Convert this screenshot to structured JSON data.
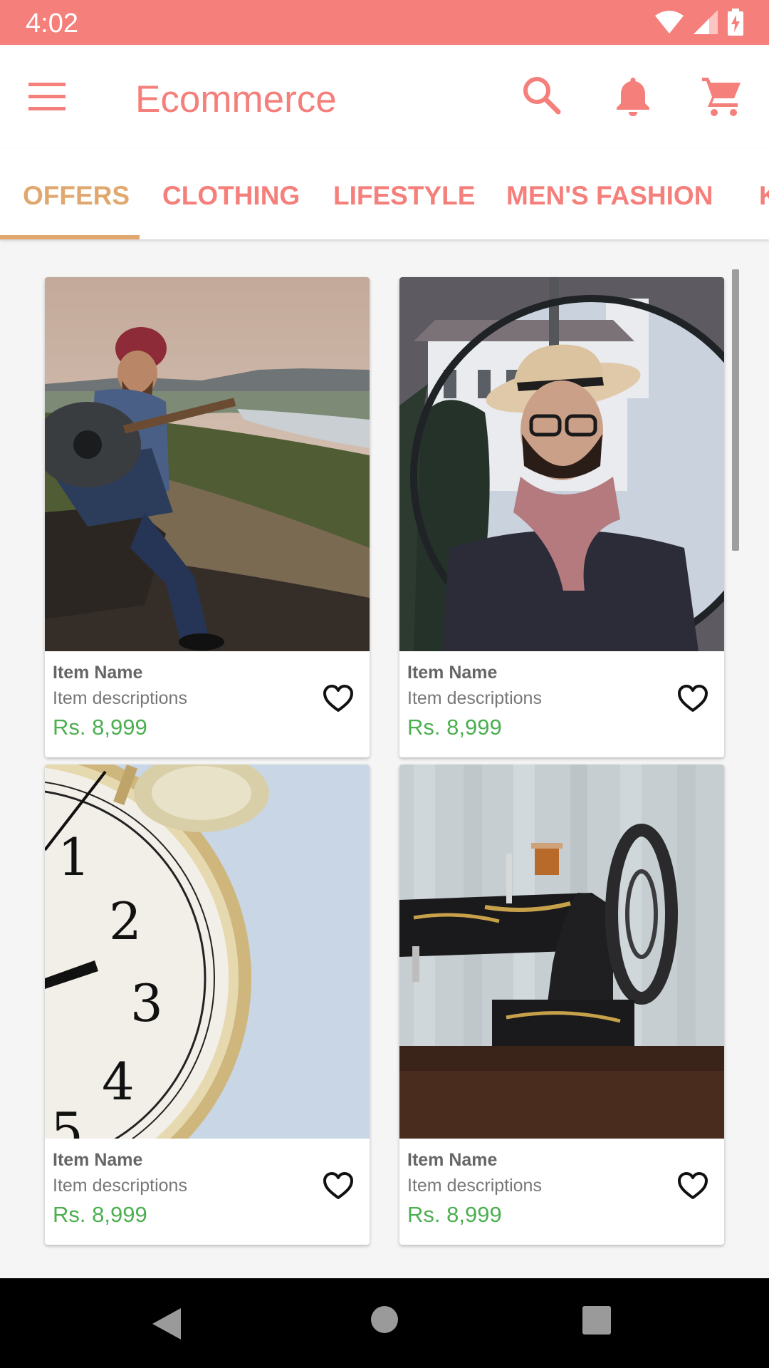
{
  "status_bar": {
    "time": "4:02"
  },
  "app_bar": {
    "title": "Ecommerce"
  },
  "tabs": [
    {
      "label": "OFFERS",
      "active": true
    },
    {
      "label": "CLOTHING",
      "active": false
    },
    {
      "label": "LIFESTYLE",
      "active": false
    },
    {
      "label": "MEN'S FASHION",
      "active": false
    },
    {
      "label": "K",
      "active": false
    }
  ],
  "products": [
    {
      "name": "Item Name",
      "description": "Item descriptions",
      "price": "Rs. 8,999",
      "image": "man-playing-guitar-photo"
    },
    {
      "name": "Item Name",
      "description": "Item descriptions",
      "price": "Rs. 8,999",
      "image": "man-in-hat-and-scarf-photo"
    },
    {
      "name": "Item Name",
      "description": "Item descriptions",
      "price": "Rs. 8,999",
      "image": "alarm-clock-photo"
    },
    {
      "name": "Item Name",
      "description": "Item descriptions",
      "price": "Rs. 8,999",
      "image": "sewing-machine-photo"
    }
  ],
  "colors": {
    "accent": "#f47f7b",
    "active_tab": "#e0a86f",
    "price": "#4caf50",
    "status_bar": "#f47f7b"
  }
}
